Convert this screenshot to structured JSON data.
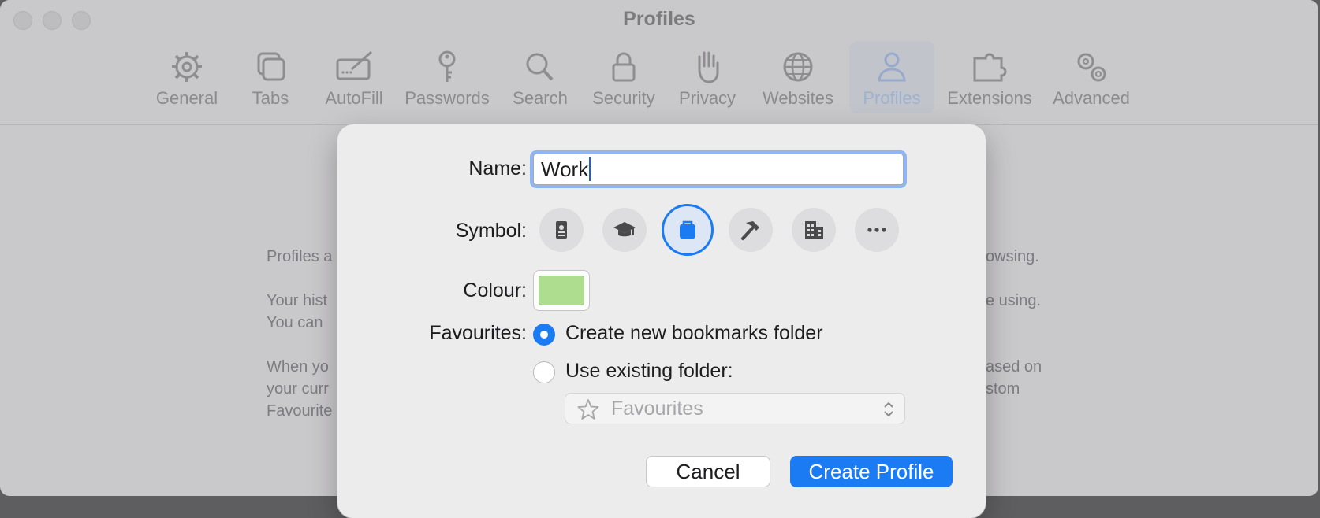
{
  "window": {
    "title": "Profiles",
    "toolbar": [
      {
        "label": "General",
        "icon": "gear-icon"
      },
      {
        "label": "Tabs",
        "icon": "tabs-icon"
      },
      {
        "label": "AutoFill",
        "icon": "autofill-icon"
      },
      {
        "label": "Passwords",
        "icon": "key-icon"
      },
      {
        "label": "Search",
        "icon": "magnifier-icon"
      },
      {
        "label": "Security",
        "icon": "lock-icon"
      },
      {
        "label": "Privacy",
        "icon": "hand-icon"
      },
      {
        "label": "Websites",
        "icon": "globe-icon"
      },
      {
        "label": "Profiles",
        "icon": "person-icon",
        "active": true
      },
      {
        "label": "Extensions",
        "icon": "puzzle-icon"
      },
      {
        "label": "Advanced",
        "icon": "gears-icon"
      }
    ]
  },
  "background_text": {
    "line1_left": "Profiles a",
    "line1_right": "owsing.",
    "line2_left": "Your hist",
    "line2_right": "e using.",
    "line3_left": "You can",
    "line4_left": "When yo",
    "line4_right": "ased on",
    "line5_left": "your curr",
    "line5_right": "stom",
    "line6_left": "Favourite"
  },
  "dialog": {
    "name_label": "Name:",
    "name_value": "Work",
    "symbol_label": "Symbol:",
    "symbols": [
      "id-badge-icon",
      "graduation-cap-icon",
      "briefcase-icon",
      "hammer-icon",
      "building-icon",
      "more-icon"
    ],
    "selected_symbol": "briefcase-icon",
    "colour_label": "Colour:",
    "colour_value": "#aedd8f",
    "favourites_label": "Favourites:",
    "option_new": "Create new bookmarks folder",
    "option_existing": "Use existing folder:",
    "selected_option": "new",
    "folder_popup_value": "Favourites",
    "cancel_label": "Cancel",
    "create_label": "Create Profile"
  },
  "colors": {
    "accent": "#1a7bf2"
  }
}
